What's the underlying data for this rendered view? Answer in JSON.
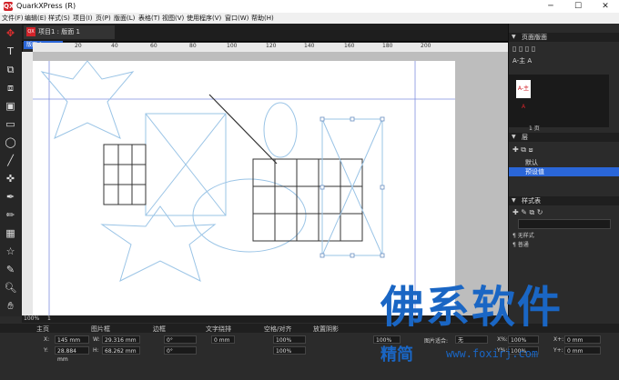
{
  "app": {
    "title": "QuarkXPress (R)",
    "logo": "QX"
  },
  "window_controls": {
    "minimize": "─",
    "maximize": "☐",
    "close": "✕"
  },
  "menu": [
    "文件(F)",
    "编辑(E)",
    "样式(S)",
    "项目(I)",
    "页(P)",
    "版面(L)",
    "表格(T)",
    "视图(V)",
    "使用程序(V)",
    "窗口(W)",
    "帮助(H)"
  ],
  "document": {
    "tab_label": "项目1 : 版面 1",
    "badge": "QX",
    "sub_tab": "版面 1"
  },
  "ruler_top": [
    "20",
    "40",
    "60",
    "80",
    "100",
    "120",
    "140",
    "160",
    "180",
    "200"
  ],
  "status": {
    "zoom": "100%",
    "page": "1"
  },
  "panels": {
    "pages": {
      "title": "页面版面",
      "master": "A-主 A",
      "page_label": "1 页"
    },
    "layers": {
      "title": "层",
      "items": [
        "默认",
        "预设值"
      ]
    },
    "styles": {
      "title": "样式表",
      "items": [
        "无样式",
        "普通"
      ]
    }
  },
  "bottom_tabs": [
    "主页",
    "图片框",
    "边框",
    "文字绕排",
    "空格/对齐",
    "放置阴影"
  ],
  "props": {
    "x_label": "X:",
    "x_value": "145 mm",
    "y_label": "Y:",
    "y_value": "28.884 mm",
    "w_label": "W:",
    "w_value": "29.316 mm",
    "h_label": "H:",
    "h_value": "68.262 mm",
    "angle1": "0°",
    "angle2": "0°",
    "stroke": "0 mm",
    "opacity1": "100%",
    "opacity2": "100%",
    "opacity3": "100%",
    "fit_label": "图片适合:",
    "fit_value": "无",
    "xpct_label": "X%:",
    "xpct_value": "100%",
    "ypct_label": "Y%:",
    "ypct_value": "100%",
    "xplus_label": "X+:",
    "xplus_value": "0 mm",
    "yplus_label": "Y+:",
    "yplus_value": "0 mm"
  },
  "watermark": {
    "big": "佛系软件",
    "small": "精简",
    "url": "www.foxirj.com"
  },
  "colors": {
    "accent": "#d2232a",
    "guide": "#7f8fdf",
    "shape": "#9ac4e6",
    "select": "#2a66d8"
  }
}
